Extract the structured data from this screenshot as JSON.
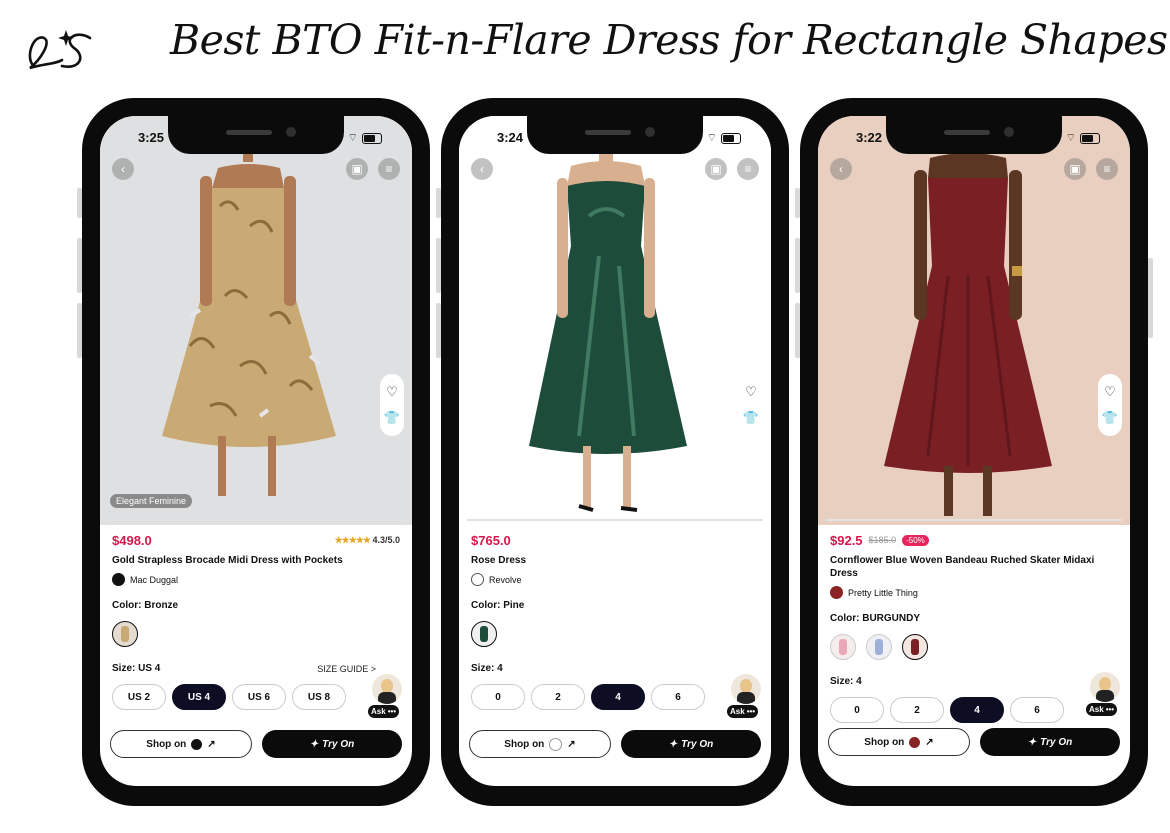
{
  "title": "Best BTO Fit-n-Flare Dress for Rectangle Shapes",
  "logo_text": "LS",
  "phones": [
    {
      "time": "3:25",
      "price": "$498.0",
      "rating": "4.3/5.0",
      "product_name": "Gold Strapless Brocade Midi Dress with Pockets",
      "brand": "Mac Duggal",
      "color_label": "Color: Bronze",
      "size_label": "Size: US 4",
      "size_guide": "SIZE GUIDE >",
      "sizes": [
        "US 2",
        "US 4",
        "US 6",
        "US 8"
      ],
      "selected_size": "US 4",
      "photo_tag": "Elegant Feminine",
      "ask_label": "Ask",
      "shop_label": "Shop on",
      "tryon_label": "Try On",
      "colors": {
        "bg": "#dfe0e1",
        "dress": "#c9a974"
      }
    },
    {
      "time": "3:24",
      "price": "$765.0",
      "product_name": "Rose Dress",
      "brand": "Revolve",
      "color_label": "Color: Pine",
      "size_label": "Size: 4",
      "sizes": [
        "0",
        "2",
        "4",
        "6"
      ],
      "selected_size": "4",
      "ask_label": "Ask",
      "shop_label": "Shop on",
      "tryon_label": "Try On",
      "colors": {
        "bg": "#ffffff",
        "dress": "#1d4c3a"
      }
    },
    {
      "time": "3:22",
      "price": "$92.5",
      "old_price": "$185.0",
      "discount": "-50%",
      "product_name": "Cornflower Blue Woven Bandeau Ruched Skater Midaxi Dress",
      "brand": "Pretty Little Thing",
      "color_label": "Color: BURGUNDY",
      "size_label": "Size: 4",
      "sizes": [
        "0",
        "2",
        "4",
        "6"
      ],
      "selected_size": "4",
      "ask_label": "Ask",
      "shop_label": "Shop on",
      "tryon_label": "Try On",
      "colors": {
        "bg": "#e9cfc0",
        "dress": "#7a1f24"
      }
    }
  ]
}
